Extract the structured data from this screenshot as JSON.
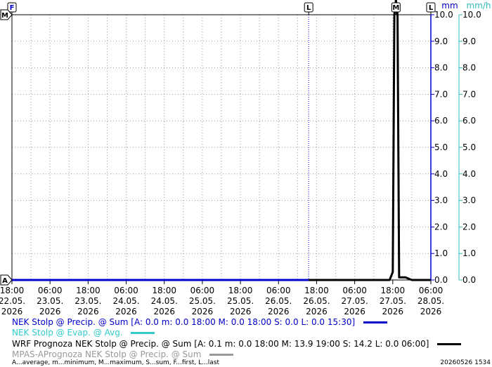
{
  "chart_data": {
    "type": "line",
    "x_ticks": [
      {
        "time": "18:00",
        "date": "22.05.",
        "year": "2026"
      },
      {
        "time": "06:00",
        "date": "23.05.",
        "year": "2026"
      },
      {
        "time": "18:00",
        "date": "23.05.",
        "year": "2026"
      },
      {
        "time": "06:00",
        "date": "24.05.",
        "year": "2026"
      },
      {
        "time": "18:00",
        "date": "24.05.",
        "year": "2026"
      },
      {
        "time": "06:00",
        "date": "25.05.",
        "year": "2026"
      },
      {
        "time": "18:00",
        "date": "25.05.",
        "year": "2026"
      },
      {
        "time": "06:00",
        "date": "26.05.",
        "year": "2026"
      },
      {
        "time": "18:00",
        "date": "26.05.",
        "year": "2026"
      },
      {
        "time": "06:00",
        "date": "27.05.",
        "year": "2026"
      },
      {
        "time": "18:00",
        "date": "27.05.",
        "year": "2026"
      },
      {
        "time": "06:00",
        "date": "28.05.",
        "year": "2026"
      }
    ],
    "x_range_hours": [
      0,
      132
    ],
    "y_left": {
      "unit": "mm",
      "ylim": [
        0,
        10
      ],
      "ticks": [
        "0.0",
        "1.0",
        "2.0",
        "3.0",
        "4.0",
        "5.0",
        "6.0",
        "7.0",
        "8.0",
        "9.0",
        "10.0"
      ],
      "color": "#0000cc"
    },
    "y_right": {
      "unit": "mm/h",
      "ylim": [
        0,
        10
      ],
      "ticks": [
        "0.0",
        "1.0",
        "2.0",
        "3.0",
        "4.0",
        "5.0",
        "6.0",
        "7.0",
        "8.0",
        "9.0",
        "10.0"
      ],
      "color": "#33bbbb"
    },
    "grid": true,
    "markers": [
      {
        "label": "F",
        "hour": 0
      },
      {
        "label": "L",
        "hour": 93.5
      },
      {
        "label": "M",
        "hour": 121
      },
      {
        "label": "L",
        "hour": 132
      }
    ],
    "axis_markers": [
      {
        "label": "M",
        "side": "left",
        "value": 10
      },
      {
        "label": "A",
        "side": "left",
        "value": 0
      }
    ],
    "series": [
      {
        "name": "NEK Stolp @ Precip. @ Sum",
        "color": "#0000cc",
        "x": [
          0,
          93.5
        ],
        "y": [
          0,
          0
        ]
      },
      {
        "name": "NEK Stolp @ Evap. @ Avg.",
        "color": "#33cccc",
        "x": [],
        "y": []
      },
      {
        "name": "WRF Prognoza NEK Stolp @ Precip. @ Sum",
        "color": "#000000",
        "x": [
          93.5,
          119,
          120,
          120.5,
          121,
          121.5,
          122,
          123,
          124,
          126,
          132
        ],
        "y": [
          0,
          0,
          0.3,
          10,
          13.9,
          10,
          0.1,
          0.1,
          0.1,
          0,
          0
        ]
      },
      {
        "name": "MPAS-APrognoza NEK Stolp @ Precip. @ Sum",
        "color": "#999999",
        "x": [],
        "y": []
      }
    ]
  },
  "legend": [
    {
      "text": "NEK Stolp @ Precip. @ Sum [A: 0.0 m: 0.0 18:00 M: 0.0 18:00 S: 0.0 L: 0.0 15:30]",
      "color": "#0000cc",
      "text_color": "#0000cc"
    },
    {
      "text": "NEK Stolp @ Evap. @ Avg.",
      "color": "#33cccc",
      "text_color": "#33cccc"
    },
    {
      "text": "WRF Prognoza NEK Stolp @ Precip. @ Sum [A: 0.1 m: 0.0 18:00 M: 13.9 19:00 S: 14.2 L: 0.0 06:00]",
      "color": "#000000",
      "text_color": "#000000"
    },
    {
      "text": "MPAS-APrognoza NEK Stolp @ Precip. @ Sum",
      "color": "#999999",
      "text_color": "#999999"
    }
  ],
  "footer": {
    "legend_key": "A...average, m...minimum, M...maximum, S...sum, F...first, L...last",
    "timestamp": "20260526 1534"
  }
}
